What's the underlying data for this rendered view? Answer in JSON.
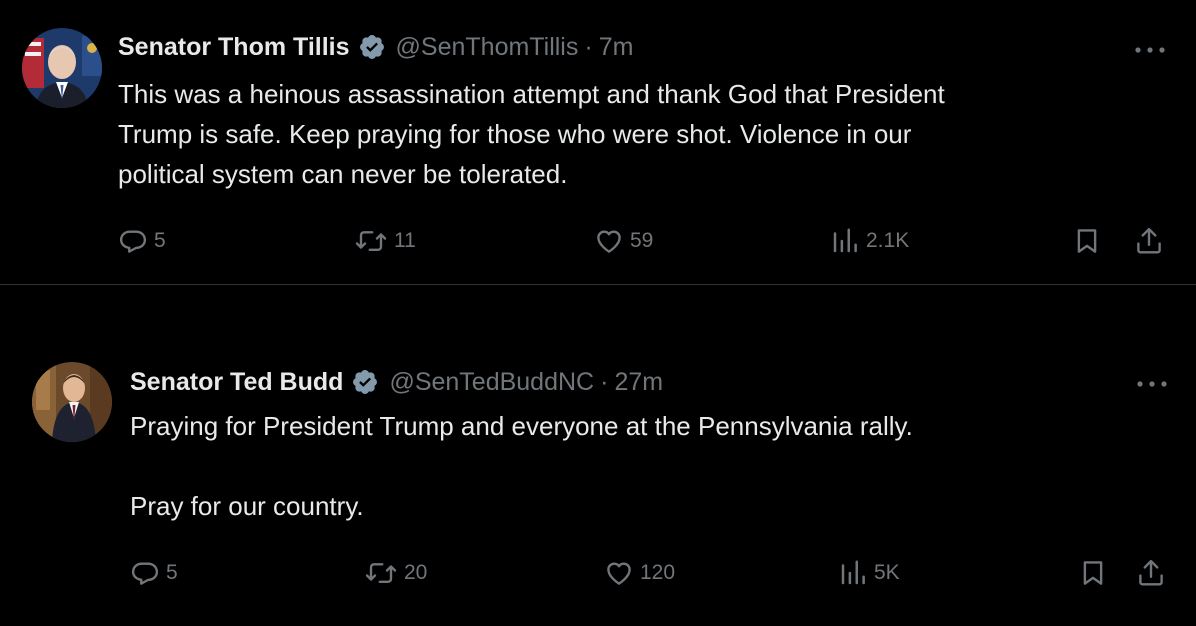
{
  "tweets": [
    {
      "author": {
        "name": "Senator Thom Tillis",
        "handle": "@SenThomTillis",
        "separator": "·",
        "time": "7m",
        "verified_color": "#829aab"
      },
      "text": "This was a heinous assassination attempt and thank God that President\nTrump is safe. Keep praying for those who were shot. Violence in our\npolitical system can never be tolerated.",
      "stats": {
        "replies": "5",
        "reposts": "11",
        "likes": "59",
        "views": "2.1K"
      }
    },
    {
      "author": {
        "name": "Senator Ted Budd",
        "handle": "@SenTedBuddNC",
        "separator": "·",
        "time": "27m",
        "verified_color": "#829aab"
      },
      "text": "Praying for President Trump and everyone at the Pennsylvania rally.\n\nPray for our country.",
      "stats": {
        "replies": "5",
        "reposts": "20",
        "likes": "120",
        "views": "5K"
      }
    }
  ],
  "icons": {
    "reply": "reply-icon",
    "repost": "repost-icon",
    "like": "heart-icon",
    "views": "views-icon",
    "bookmark": "bookmark-icon",
    "share": "share-icon",
    "more": "more-icon",
    "verified": "verified-badge-icon"
  },
  "colors": {
    "background": "#000000",
    "text_primary": "#e7e9ea",
    "text_secondary": "#71767b",
    "divider": "#2f3336"
  }
}
